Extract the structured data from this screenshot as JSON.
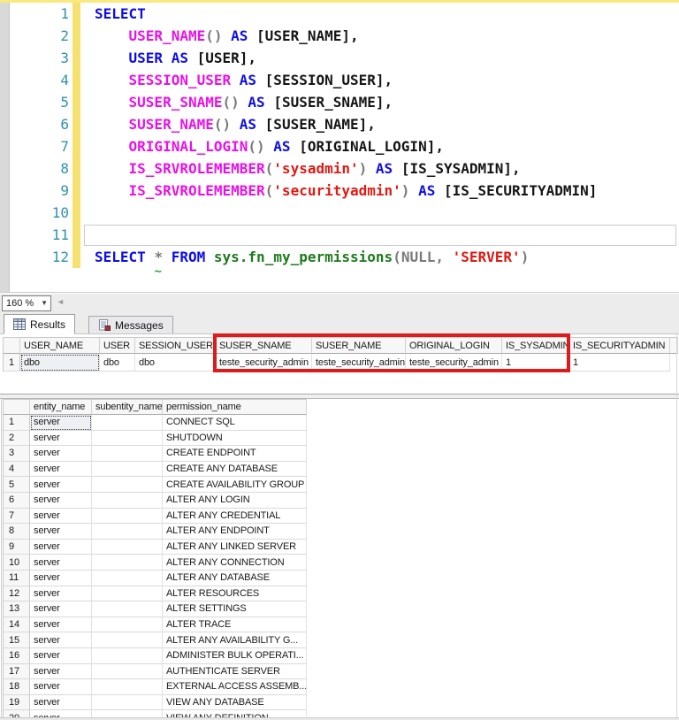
{
  "editor": {
    "language": "sql",
    "lines": [
      {
        "num": "1",
        "tokens": [
          {
            "t": "SELECT",
            "c": "keyword"
          }
        ]
      },
      {
        "num": "2",
        "tokens": [
          {
            "t": "    ",
            "c": "plain"
          },
          {
            "t": "USER_NAME",
            "c": "function"
          },
          {
            "t": "()",
            "c": "operator"
          },
          {
            "t": " ",
            "c": "plain"
          },
          {
            "t": "AS",
            "c": "keyword"
          },
          {
            "t": " ",
            "c": "plain"
          },
          {
            "t": "[USER_NAME],",
            "c": "plain"
          }
        ]
      },
      {
        "num": "3",
        "tokens": [
          {
            "t": "    ",
            "c": "plain"
          },
          {
            "t": "USER",
            "c": "keyword"
          },
          {
            "t": " ",
            "c": "plain"
          },
          {
            "t": "AS",
            "c": "keyword"
          },
          {
            "t": " ",
            "c": "plain"
          },
          {
            "t": "[USER],",
            "c": "plain"
          }
        ]
      },
      {
        "num": "4",
        "tokens": [
          {
            "t": "    ",
            "c": "plain"
          },
          {
            "t": "SESSION_USER",
            "c": "function"
          },
          {
            "t": " ",
            "c": "plain"
          },
          {
            "t": "AS",
            "c": "keyword"
          },
          {
            "t": " ",
            "c": "plain"
          },
          {
            "t": "[SESSION_USER],",
            "c": "plain"
          }
        ]
      },
      {
        "num": "5",
        "tokens": [
          {
            "t": "    ",
            "c": "plain"
          },
          {
            "t": "SUSER_SNAME",
            "c": "function"
          },
          {
            "t": "()",
            "c": "operator"
          },
          {
            "t": " ",
            "c": "plain"
          },
          {
            "t": "AS",
            "c": "keyword"
          },
          {
            "t": " ",
            "c": "plain"
          },
          {
            "t": "[SUSER_SNAME],",
            "c": "plain"
          }
        ]
      },
      {
        "num": "6",
        "tokens": [
          {
            "t": "    ",
            "c": "plain"
          },
          {
            "t": "SUSER_NAME",
            "c": "function"
          },
          {
            "t": "()",
            "c": "operator"
          },
          {
            "t": " ",
            "c": "plain"
          },
          {
            "t": "AS",
            "c": "keyword"
          },
          {
            "t": " ",
            "c": "plain"
          },
          {
            "t": "[SUSER_NAME],",
            "c": "plain"
          }
        ]
      },
      {
        "num": "7",
        "tokens": [
          {
            "t": "    ",
            "c": "plain"
          },
          {
            "t": "ORIGINAL_LOGIN",
            "c": "function"
          },
          {
            "t": "()",
            "c": "operator"
          },
          {
            "t": " ",
            "c": "plain"
          },
          {
            "t": "AS",
            "c": "keyword"
          },
          {
            "t": " ",
            "c": "plain"
          },
          {
            "t": "[ORIGINAL_LOGIN],",
            "c": "plain"
          }
        ]
      },
      {
        "num": "8",
        "tokens": [
          {
            "t": "    ",
            "c": "plain"
          },
          {
            "t": "IS_SRVROLEMEMBER",
            "c": "function"
          },
          {
            "t": "(",
            "c": "operator"
          },
          {
            "t": "'sysadmin'",
            "c": "string"
          },
          {
            "t": ")",
            "c": "operator"
          },
          {
            "t": " ",
            "c": "plain"
          },
          {
            "t": "AS",
            "c": "keyword"
          },
          {
            "t": " ",
            "c": "plain"
          },
          {
            "t": "[IS_SYSADMIN],",
            "c": "plain"
          }
        ]
      },
      {
        "num": "9",
        "tokens": [
          {
            "t": "    ",
            "c": "plain"
          },
          {
            "t": "IS_SRVROLEMEMBER",
            "c": "function"
          },
          {
            "t": "(",
            "c": "operator"
          },
          {
            "t": "'securityadmin'",
            "c": "string"
          },
          {
            "t": ")",
            "c": "operator"
          },
          {
            "t": " ",
            "c": "plain"
          },
          {
            "t": "AS",
            "c": "keyword"
          },
          {
            "t": " ",
            "c": "plain"
          },
          {
            "t": "[IS_SECURITYADMIN]",
            "c": "plain"
          }
        ]
      },
      {
        "num": "10",
        "tokens": []
      },
      {
        "num": "11",
        "tokens": [],
        "current": true
      },
      {
        "num": "12",
        "tokens": [
          {
            "t": "SELECT",
            "c": "keyword"
          },
          {
            "t": " ",
            "c": "plain"
          },
          {
            "t": "*",
            "c": "operator",
            "sq": true
          },
          {
            "t": " ",
            "c": "plain"
          },
          {
            "t": "FROM",
            "c": "keyword"
          },
          {
            "t": " ",
            "c": "plain"
          },
          {
            "t": "sys.fn_my_permissions",
            "c": "table_function"
          },
          {
            "t": "(",
            "c": "operator"
          },
          {
            "t": "NULL",
            "c": "operator"
          },
          {
            "t": ", ",
            "c": "operator"
          },
          {
            "t": "'SERVER'",
            "c": "string"
          },
          {
            "t": ")",
            "c": "operator"
          }
        ]
      }
    ]
  },
  "colors": {
    "keyword": "#0d0de8",
    "function": "#e812e8",
    "string": "#de1b14",
    "operator": "#7a7a7a",
    "plain": "#151515",
    "table_function": "#1e7a1e",
    "line_number": "#2e91af",
    "change_tracking": "#f5e170",
    "squiggle": "#27a327",
    "highlight_box": "#de1b1b"
  },
  "results_toolbar": {
    "zoom_value": "160 %",
    "scroll_left_glyph": "◄",
    "caret_glyph": "▼"
  },
  "tabs": {
    "results": "Results",
    "messages": "Messages",
    "active": "Results"
  },
  "results_grid": {
    "columns": [
      "USER_NAME",
      "USER",
      "SESSION_USER",
      "SUSER_SNAME",
      "SUSER_NAME",
      "ORIGINAL_LOGIN",
      "IS_SYSADMIN",
      "IS_SECURITYADMIN"
    ],
    "rows": [
      {
        "num": "1",
        "cells": [
          "dbo",
          "dbo",
          "dbo",
          "teste_security_admin",
          "teste_security_admin",
          "teste_security_admin",
          "1",
          "1"
        ]
      }
    ],
    "selected": {
      "row": 0,
      "column": "USER_NAME"
    },
    "highlighted_columns": [
      "SUSER_SNAME",
      "SUSER_NAME",
      "ORIGINAL_LOGIN",
      "IS_SYSADMIN"
    ]
  },
  "permissions_grid": {
    "columns": [
      "entity_name",
      "subentity_name",
      "permission_name"
    ],
    "rows": [
      {
        "num": "1",
        "cells": [
          "server",
          "",
          "CONNECT SQL"
        ]
      },
      {
        "num": "2",
        "cells": [
          "server",
          "",
          "SHUTDOWN"
        ]
      },
      {
        "num": "3",
        "cells": [
          "server",
          "",
          "CREATE ENDPOINT"
        ]
      },
      {
        "num": "4",
        "cells": [
          "server",
          "",
          "CREATE ANY DATABASE"
        ]
      },
      {
        "num": "5",
        "cells": [
          "server",
          "",
          "CREATE AVAILABILITY GROUP"
        ]
      },
      {
        "num": "6",
        "cells": [
          "server",
          "",
          "ALTER ANY LOGIN"
        ]
      },
      {
        "num": "7",
        "cells": [
          "server",
          "",
          "ALTER ANY CREDENTIAL"
        ]
      },
      {
        "num": "8",
        "cells": [
          "server",
          "",
          "ALTER ANY ENDPOINT"
        ]
      },
      {
        "num": "9",
        "cells": [
          "server",
          "",
          "ALTER ANY LINKED SERVER"
        ]
      },
      {
        "num": "10",
        "cells": [
          "server",
          "",
          "ALTER ANY CONNECTION"
        ]
      },
      {
        "num": "11",
        "cells": [
          "server",
          "",
          "ALTER ANY DATABASE"
        ]
      },
      {
        "num": "12",
        "cells": [
          "server",
          "",
          "ALTER RESOURCES"
        ]
      },
      {
        "num": "13",
        "cells": [
          "server",
          "",
          "ALTER SETTINGS"
        ]
      },
      {
        "num": "14",
        "cells": [
          "server",
          "",
          "ALTER TRACE"
        ]
      },
      {
        "num": "15",
        "cells": [
          "server",
          "",
          "ALTER ANY AVAILABILITY G..."
        ]
      },
      {
        "num": "16",
        "cells": [
          "server",
          "",
          "ADMINISTER BULK OPERATI..."
        ]
      },
      {
        "num": "17",
        "cells": [
          "server",
          "",
          "AUTHENTICATE SERVER"
        ]
      },
      {
        "num": "18",
        "cells": [
          "server",
          "",
          "EXTERNAL ACCESS ASSEMB..."
        ]
      },
      {
        "num": "19",
        "cells": [
          "server",
          "",
          "VIEW ANY DATABASE"
        ]
      },
      {
        "num": "20",
        "cells": [
          "server",
          "",
          "VIEW ANY DEFINITION"
        ]
      }
    ],
    "selected": {
      "row": 0,
      "column": "entity_name"
    }
  }
}
